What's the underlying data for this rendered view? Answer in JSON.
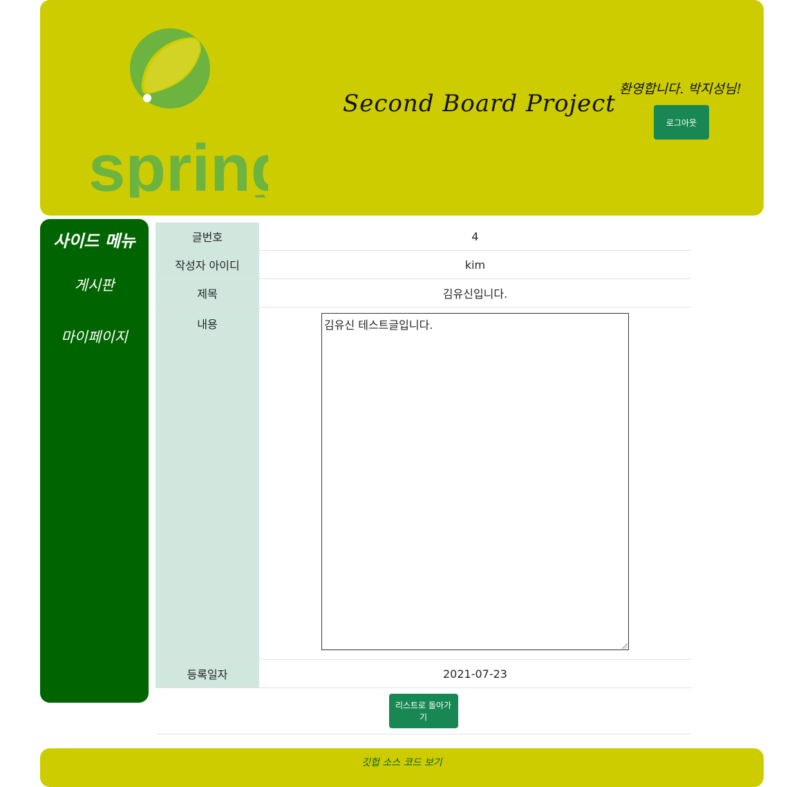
{
  "header": {
    "logo_text": "spring",
    "title": "Second Board Project",
    "welcome": "환영합니다. 박지성님!",
    "logout_label": "로그아웃"
  },
  "sidebar": {
    "title": "사이드 메뉴",
    "items": [
      {
        "label": "게시판"
      },
      {
        "label": "마이페이지"
      }
    ]
  },
  "post": {
    "no_label": "글번호",
    "no_value": "4",
    "writer_label": "작성자 아이디",
    "writer_value": "kim",
    "subject_label": "제목",
    "subject_value": "김유신입니다.",
    "content_label": "내용",
    "content_value": "김유신 테스트글입니다.",
    "date_label": "등록일자",
    "date_value": "2021-07-23",
    "back_label": "리스트로 돌아가기"
  },
  "footer": {
    "link_label": "깃헙 소스 코드 보기"
  },
  "colors": {
    "header_bg": "#cccc00",
    "sidebar_bg": "#006400",
    "button_bg": "#198754",
    "label_bg": "#d1e7dd",
    "logo_green": "#6db33f"
  }
}
